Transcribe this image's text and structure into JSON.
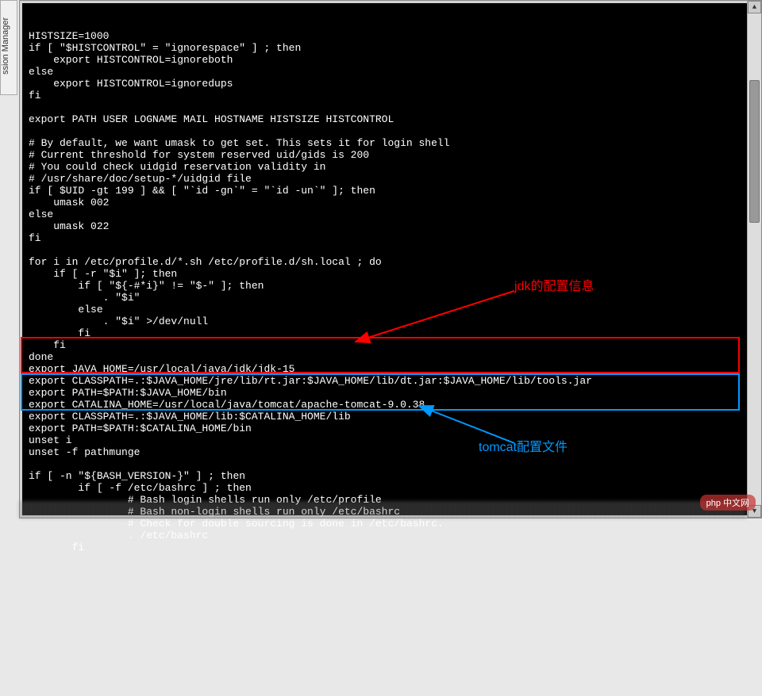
{
  "sidebar": {
    "tab_label": "ssion Manager"
  },
  "terminal": {
    "lines": [
      "HISTSIZE=1000",
      "if [ \"$HISTCONTROL\" = \"ignorespace\" ] ; then",
      "    export HISTCONTROL=ignoreboth",
      "else",
      "    export HISTCONTROL=ignoredups",
      "fi",
      "",
      "export PATH USER LOGNAME MAIL HOSTNAME HISTSIZE HISTCONTROL",
      "",
      "# By default, we want umask to get set. This sets it for login shell",
      "# Current threshold for system reserved uid/gids is 200",
      "# You could check uidgid reservation validity in",
      "# /usr/share/doc/setup-*/uidgid file",
      "if [ $UID -gt 199 ] && [ \"`id -gn`\" = \"`id -un`\" ]; then",
      "    umask 002",
      "else",
      "    umask 022",
      "fi",
      "",
      "for i in /etc/profile.d/*.sh /etc/profile.d/sh.local ; do",
      "    if [ -r \"$i\" ]; then",
      "        if [ \"${-#*i}\" != \"$-\" ]; then",
      "            . \"$i\"",
      "        else",
      "            . \"$i\" >/dev/null",
      "        fi",
      "    fi",
      "done",
      "export JAVA_HOME=/usr/local/java/jdk/jdk-15",
      "export CLASSPATH=.:$JAVA_HOME/jre/lib/rt.jar:$JAVA_HOME/lib/dt.jar:$JAVA_HOME/lib/tools.jar",
      "export PATH=$PATH:$JAVA_HOME/bin",
      "export CATALINA_HOME=/usr/local/java/tomcat/apache-tomcat-9.0.38",
      "export CLASSPATH=.:$JAVA_HOME/lib:$CATALINA_HOME/lib",
      "export PATH=$PATH:$CATALINA_HOME/bin",
      "unset i",
      "unset -f pathmunge",
      "",
      "if [ -n \"${BASH_VERSION-}\" ] ; then",
      "        if [ -f /etc/bashrc ] ; then",
      "                # Bash login shells run only /etc/profile",
      "                # Bash non-login shells run only /etc/bashrc",
      "                # Check for double sourcing is done in /etc/bashrc.",
      "                . /etc/bashrc",
      "       fi"
    ]
  },
  "annotations": {
    "jdk_label": "jdk的配置信息",
    "tomcat_label": "tomcat配置文件"
  },
  "watermark": {
    "text": "php 中文网"
  },
  "scrollbar": {
    "up": "▲",
    "down": "▼"
  }
}
